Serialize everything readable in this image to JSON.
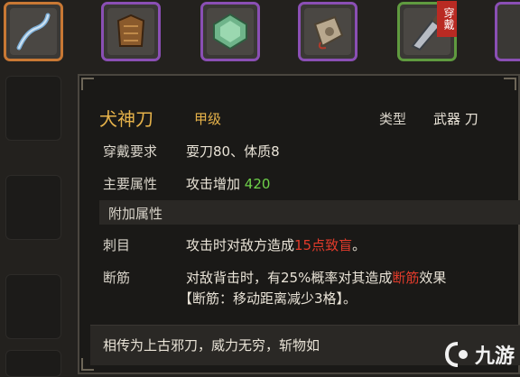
{
  "equipment_slots": [
    {
      "name": "weapon-slot",
      "icon": "whip-icon",
      "rarity": "orange"
    },
    {
      "name": "armor-slot",
      "icon": "leather-armor-icon",
      "rarity": "purple"
    },
    {
      "name": "jade-slot",
      "icon": "jade-stone-icon",
      "rarity": "purple"
    },
    {
      "name": "pouch-slot",
      "icon": "pouch-icon",
      "rarity": "purple"
    },
    {
      "name": "blade-slot",
      "icon": "cleaver-blade-icon",
      "rarity": "green",
      "badge": "穿戴"
    }
  ],
  "tooltip": {
    "item_name": "犬神刀",
    "grade": "甲级",
    "type_label": "类型",
    "type_value": "武器 刀",
    "requirement_label": "穿戴要求",
    "requirement_value": "耍刀80、体质8",
    "main_attr_label": "主要属性",
    "main_attr_text": "攻击增加",
    "main_attr_value": "420",
    "extra_section": "附加属性",
    "extras": [
      {
        "label": "刺目",
        "before": "攻击时对敌方造成",
        "highlight": "15点致盲",
        "after": "。"
      },
      {
        "label": "断筋",
        "before": "对敌背击时，有25%概率对其造成",
        "highlight": "断筋",
        "after": "效果",
        "line2": "【断筋：移动距离减少3格】。"
      }
    ],
    "description": "相传为上古邪刀，威力无穷，斩物如"
  },
  "watermark": {
    "text": "九游"
  },
  "colors": {
    "gold": "#e6b24a",
    "green": "#6fd24a",
    "red": "#e23b2b",
    "orange_border": "#c87834",
    "purple_border": "#8a4fb4",
    "green_border": "#5f9a3f"
  }
}
